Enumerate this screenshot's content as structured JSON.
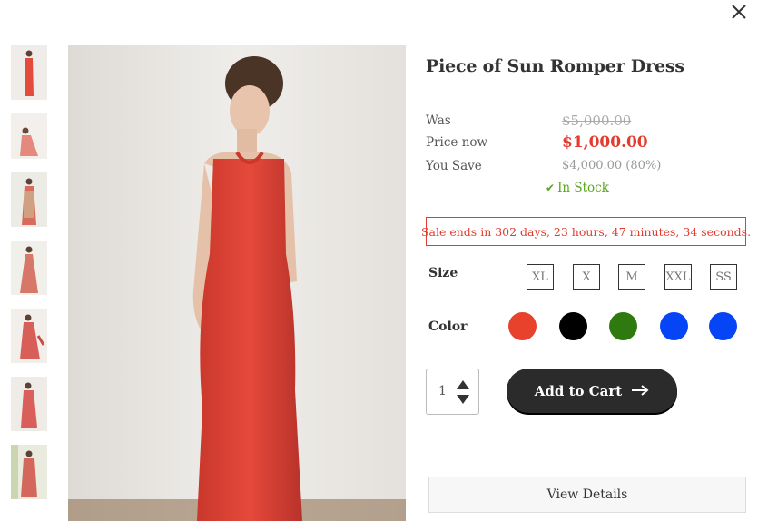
{
  "product": {
    "title": "Piece of Sun Romper Dress",
    "was_label": "Was",
    "was_price": "$5,000.00",
    "now_label": "Price now",
    "now_price": "$1,000.00",
    "save_label": "You Save",
    "save_value": "$4,000.00 (80%)",
    "stock_text": "In Stock"
  },
  "sale_banner": "Sale ends in 302 days, 23 hours, 47 minutes, 34 seconds.",
  "size": {
    "label": "Size",
    "options": [
      "XL",
      "X",
      "M",
      "XXL",
      "SS"
    ]
  },
  "color": {
    "label": "Color",
    "options": [
      "#e8412c",
      "#000000",
      "#2f7a0f",
      "#0645f5",
      "#0645f5"
    ]
  },
  "quantity": "1",
  "add_to_cart_label": "Add to Cart",
  "view_details_label": "View Details",
  "icons": {
    "close": "close-icon",
    "check": "check-icon",
    "arrow": "arrow-right-icon"
  }
}
